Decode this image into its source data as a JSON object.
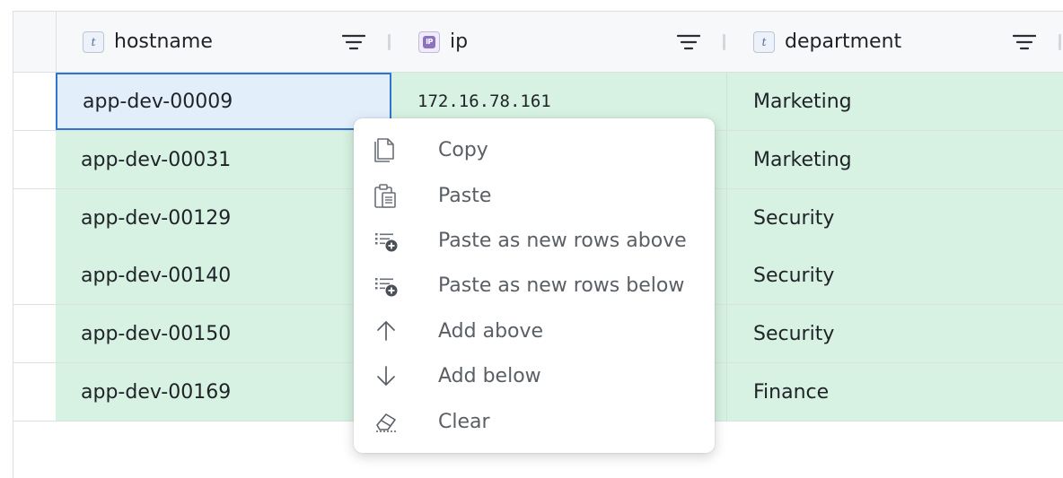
{
  "columns": [
    {
      "name": "hostname",
      "type_badge": "t"
    },
    {
      "name": "ip",
      "type_badge": "IP"
    },
    {
      "name": "department",
      "type_badge": "t"
    }
  ],
  "rows": [
    {
      "hostname": "app-dev-00009",
      "ip": "172.16.78.161",
      "department": "Marketing",
      "selected": true
    },
    {
      "hostname": "app-dev-00031",
      "ip": "",
      "department": "Marketing"
    },
    {
      "hostname": "app-dev-00129",
      "ip": "",
      "department": "Security"
    },
    {
      "hostname": "app-dev-00140",
      "ip": "",
      "department": "Security"
    },
    {
      "hostname": "app-dev-00150",
      "ip": "",
      "department": "Security"
    },
    {
      "hostname": "app-dev-00169",
      "ip": "",
      "department": "Finance"
    }
  ],
  "context_menu": {
    "items": [
      {
        "label": "Copy",
        "icon": "copy-icon"
      },
      {
        "label": "Paste",
        "icon": "paste-icon"
      },
      {
        "label": "Paste as new rows above",
        "icon": "paste-rows-above-icon"
      },
      {
        "label": "Paste as new rows below",
        "icon": "paste-rows-below-icon"
      },
      {
        "label": "Add above",
        "icon": "arrow-up-icon"
      },
      {
        "label": "Add below",
        "icon": "arrow-down-icon"
      },
      {
        "label": "Clear",
        "icon": "eraser-icon"
      }
    ]
  },
  "colors": {
    "row_fill": "#d7f2e2",
    "selection_border": "#2f74d0",
    "selection_fill": "#e3eefb"
  }
}
